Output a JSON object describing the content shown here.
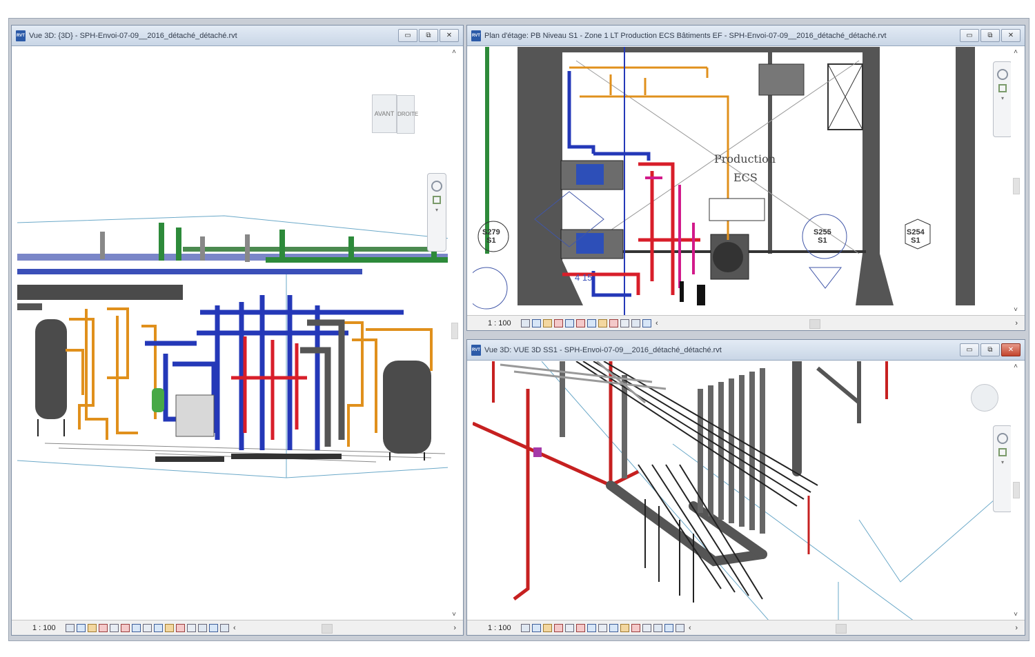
{
  "windows": {
    "left": {
      "title": "Vue 3D: {3D} - SPH-Envoi-07-09__2016_détaché_détaché.rvt",
      "scale": "1 : 100",
      "viewcube": {
        "face_front": "AVANT",
        "face_right": "DROITE"
      }
    },
    "top_right": {
      "title": "Plan d'étage: PB Niveau S1 - Zone 1 LT Production ECS  Bâtiments EF - SPH-Envoi-07-09__2016_détaché_détaché.rvt",
      "scale": "1 : 100",
      "room_name": "Production",
      "room_name_2": "ECS",
      "room_tags": [
        {
          "number": "S279",
          "level": "S1"
        },
        {
          "number": "S255",
          "level": "S1"
        },
        {
          "number": "S254",
          "level": "S1"
        }
      ],
      "dim_text": "4  15"
    },
    "bottom_right": {
      "title": "Vue 3D: VUE 3D SS1 - SPH-Envoi-07-09__2016_détaché_détaché.rvt",
      "scale": "1 : 100"
    }
  },
  "controls": {
    "minimize": "▭",
    "restore": "⧉",
    "close": "✕"
  },
  "scroll": {
    "up": "˄",
    "down": "˅",
    "left": "‹",
    "right": "›"
  },
  "colors": {
    "pipe_orange": "#e0901c",
    "pipe_blue": "#2438b8",
    "pipe_red": "#d81e2a",
    "pipe_green": "#2d8a3a",
    "pipe_magenta": "#d21a8a",
    "equipment_grey": "#4b4b4b"
  }
}
